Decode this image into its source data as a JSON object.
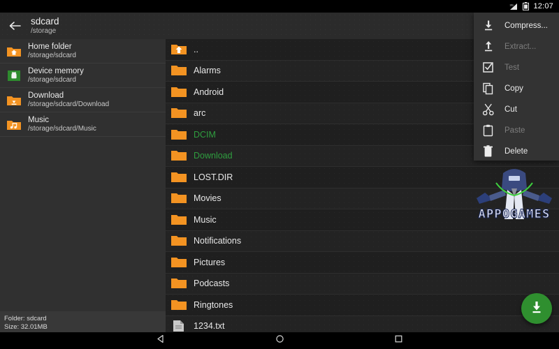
{
  "statusbar": {
    "time": "12:07",
    "signal_icon": "signal-icon",
    "battery_icon": "battery-icon"
  },
  "actionbar": {
    "back_icon": "back-arrow-icon",
    "title": "sdcard",
    "subtitle": "/storage",
    "search_icon": "search-icon",
    "select_all_icon": "double-check-icon"
  },
  "sidebar": {
    "items": [
      {
        "name": "Home folder",
        "path": "/storage/sdcard",
        "icon": "home-folder-icon"
      },
      {
        "name": "Device memory",
        "path": "/storage/sdcard",
        "icon": "android-device-icon"
      },
      {
        "name": "Download",
        "path": "/storage/sdcard/Download",
        "icon": "download-folder-icon"
      },
      {
        "name": "Music",
        "path": "/storage/sdcard/Music",
        "icon": "music-folder-icon"
      }
    ],
    "status": {
      "folder": "Folder: sdcard",
      "size": "Size: 32.01MB"
    }
  },
  "filelist": {
    "rows": [
      {
        "name": "..",
        "icon": "parent-folder-icon",
        "selected": false
      },
      {
        "name": "Alarms",
        "icon": "folder-icon",
        "selected": false
      },
      {
        "name": "Android",
        "icon": "folder-icon",
        "selected": false
      },
      {
        "name": "arc",
        "icon": "folder-icon",
        "selected": false
      },
      {
        "name": "DCIM",
        "icon": "folder-icon",
        "selected": true
      },
      {
        "name": "Download",
        "icon": "folder-icon",
        "selected": true
      },
      {
        "name": "LOST.DIR",
        "icon": "folder-icon",
        "selected": false
      },
      {
        "name": "Movies",
        "icon": "folder-icon",
        "selected": false
      },
      {
        "name": "Music",
        "icon": "folder-icon",
        "selected": false
      },
      {
        "name": "Notifications",
        "icon": "folder-icon",
        "selected": false
      },
      {
        "name": "Pictures",
        "icon": "folder-icon",
        "selected": false
      },
      {
        "name": "Podcasts",
        "icon": "folder-icon",
        "selected": false
      },
      {
        "name": "Ringtones",
        "icon": "folder-icon",
        "selected": false
      },
      {
        "name": "1234.txt",
        "icon": "text-file-icon",
        "selected": false
      }
    ]
  },
  "contextmenu": {
    "items": [
      {
        "label": "Compress...",
        "icon": "compress-icon",
        "enabled": true
      },
      {
        "label": "Extract...",
        "icon": "extract-icon",
        "enabled": false
      },
      {
        "label": "Test",
        "icon": "test-icon",
        "enabled": false
      },
      {
        "label": "Copy",
        "icon": "copy-icon",
        "enabled": true
      },
      {
        "label": "Cut",
        "icon": "cut-icon",
        "enabled": true
      },
      {
        "label": "Paste",
        "icon": "paste-icon",
        "enabled": false
      },
      {
        "label": "Delete",
        "icon": "delete-icon",
        "enabled": true
      }
    ]
  },
  "fab": {
    "icon": "download-icon",
    "color": "#2f8f2f"
  },
  "watermark": {
    "text": "APPOGAMES"
  },
  "navbar": {
    "back_icon": "nav-back-icon",
    "home_icon": "nav-home-icon",
    "recents_icon": "nav-recents-icon"
  },
  "colors": {
    "selected_text": "#2f9e3f",
    "folder_orange": "#f39322",
    "accent_green": "#2f8f2f"
  }
}
